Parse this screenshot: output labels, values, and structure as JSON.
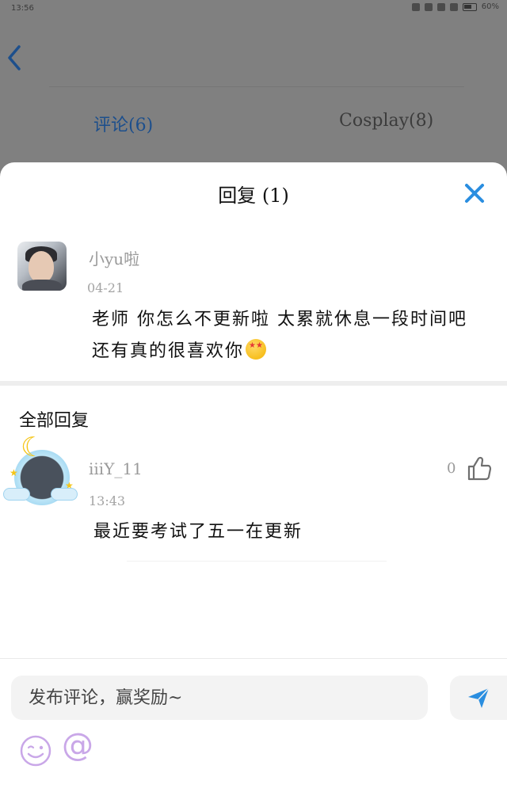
{
  "status_bar": {
    "time": "13:56",
    "battery": "60%"
  },
  "background": {
    "tabs": [
      {
        "label": "评论(6)",
        "active": true
      },
      {
        "label": "Cosplay(8)",
        "active": false
      }
    ]
  },
  "sheet": {
    "title": "回复 (1)",
    "main_comment": {
      "user": "小yu啦",
      "time": "04-21",
      "line1": "老师 你怎么不更新啦 太累就休息一段时间吧",
      "line2": "还有真的很喜欢你"
    },
    "section_title": "全部回复",
    "replies": [
      {
        "user": "iiiY_11",
        "time": "13:43",
        "text": "最近要考试了五一在更新",
        "likes": "0"
      }
    ],
    "input": {
      "placeholder": "发布评论，赢奖励~"
    },
    "at_symbol": "@"
  },
  "colors": {
    "accent": "#2a8ee0",
    "muted_text": "#9a9a9a",
    "emoji_accent": "#c9a7e8"
  },
  "icons": [
    "back-arrow-icon",
    "close-icon",
    "thumbs-up-icon",
    "send-icon",
    "emoji-face-icon",
    "at-icon"
  ]
}
